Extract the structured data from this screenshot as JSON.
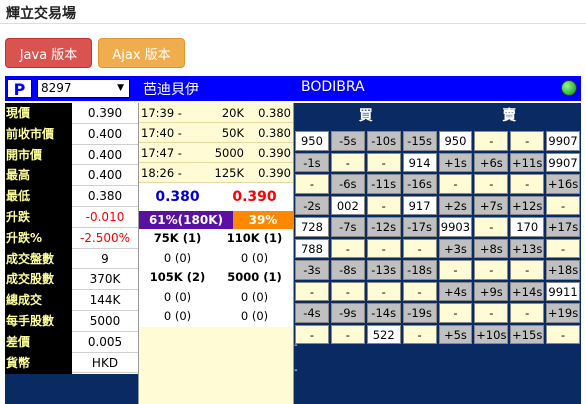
{
  "app": {
    "title": "輝立交易場"
  },
  "buttons": {
    "java": "Java 版本",
    "ajax": "Ajax 版本"
  },
  "header": {
    "logo": "P",
    "stock_code": "8297",
    "stock_name_cn": "芭迪貝伊",
    "stock_name_en": "BODIBRA",
    "status": "green"
  },
  "quote": {
    "labels": [
      "現價",
      "前收市價",
      "開市價",
      "最高",
      "最低",
      "升跌",
      "升跌%",
      "成交盤數",
      "成交股數",
      "總成交",
      "每手股數",
      "差價",
      "貨幣"
    ],
    "values": [
      "0.390",
      "0.400",
      "0.400",
      "0.400",
      "0.380",
      "-0.010",
      "-2.500%",
      "9",
      "370K",
      "144K",
      "5000",
      "0.005",
      "HKD"
    ]
  },
  "ticks": [
    {
      "time": "17:39 -",
      "vol": "20K",
      "price": "0.380"
    },
    {
      "time": "17:40 -",
      "vol": "50K",
      "price": "0.380"
    },
    {
      "time": "17:47 -",
      "vol": "5000",
      "price": "0.390"
    },
    {
      "time": "18:26 -",
      "vol": "125K",
      "price": "0.390"
    }
  ],
  "bidask": {
    "bid_price": "0.380",
    "ask_price": "0.390",
    "bid_pct": "61%(180K)",
    "ask_pct": "39%(115K)",
    "bid_pct_value": 61,
    "ask_pct_value": 39,
    "queue": [
      {
        "bid": "75K (1)",
        "ask": "110K (1)"
      },
      {
        "bid": "0 (0)",
        "ask": "0 (0)"
      },
      {
        "bid": "105K (2)",
        "ask": "5000 (1)"
      },
      {
        "bid": "0 (0)",
        "ask": "0 (0)"
      },
      {
        "bid": "0 (0)",
        "ask": "0 (0)"
      }
    ]
  },
  "broker": {
    "buy_label": "買",
    "sell_label": "賣",
    "rows": [
      [
        "950",
        "-5s",
        "-10s",
        "-15s",
        "950",
        "-",
        "-",
        "9907"
      ],
      [
        "-1s",
        "-",
        "-",
        "914",
        "+1s",
        "+6s",
        "+11s",
        "9907"
      ],
      [
        "-",
        "-6s",
        "-11s",
        "-16s",
        "-",
        "-",
        "-",
        "+16s"
      ],
      [
        "-2s",
        "002",
        "-",
        "917",
        "+2s",
        "+7s",
        "+12s",
        "-"
      ],
      [
        "728",
        "-7s",
        "-12s",
        "-17s",
        "9903",
        "-",
        "170",
        "+17s"
      ],
      [
        "788",
        "-",
        "-",
        "-",
        "+3s",
        "+8s",
        "+13s",
        "-"
      ],
      [
        "-3s",
        "-8s",
        "-13s",
        "-18s",
        "-",
        "-",
        "-",
        "+18s"
      ],
      [
        "-",
        "-",
        "-",
        "-",
        "+4s",
        "+9s",
        "+14s",
        "9911"
      ],
      [
        "-4s",
        "-9s",
        "-14s",
        "-19s",
        "-",
        "-",
        "-",
        "+19s"
      ],
      [
        "-",
        "-",
        "522",
        "-",
        "+5s",
        "+10s",
        "+15s",
        "-"
      ]
    ]
  }
}
